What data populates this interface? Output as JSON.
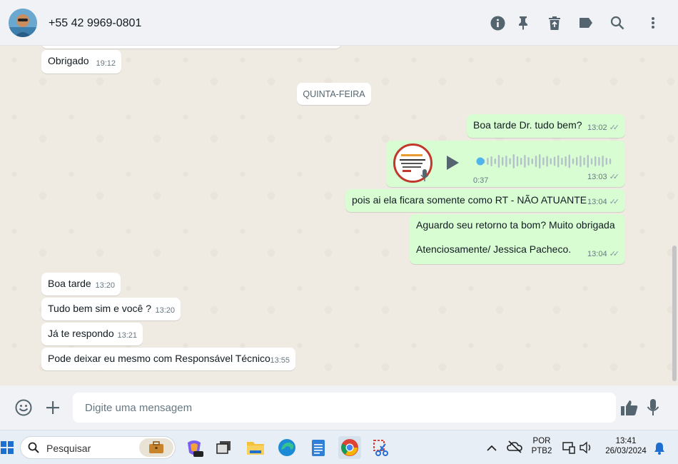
{
  "header": {
    "contact_name": "+55 42 9969-0801",
    "icons": [
      "info-icon",
      "pin-icon",
      "delete-icon",
      "label-icon",
      "search-icon",
      "menu-icon"
    ]
  },
  "chat": {
    "day_separator": "QUINTA-FEIRA",
    "messages": [
      {
        "dir": "in",
        "text": "Obrigado",
        "time": "19:12"
      },
      {
        "dir": "out",
        "text": "Boa tarde Dr. tudo bem?",
        "time": "13:02"
      },
      {
        "dir": "out",
        "type": "audio",
        "duration": "0:37",
        "time": "13:03",
        "progress": 0
      },
      {
        "dir": "out",
        "text": "pois ai ela ficara somente como RT - NÃO ATUANTE",
        "time": "13:04"
      },
      {
        "dir": "out",
        "text_line1": "Aguardo seu retorno ta bom? Muito obrigada",
        "text_line2": "Atenciosamente/ Jessica Pacheco.",
        "time": "13:04"
      },
      {
        "dir": "in",
        "text": "Boa tarde",
        "time": "13:20"
      },
      {
        "dir": "in",
        "text": "Tudo bem sim e você ?",
        "time": "13:20"
      },
      {
        "dir": "in",
        "text": "Já te respondo",
        "time": "13:21"
      },
      {
        "dir": "in",
        "text": "Pode deixar eu mesmo com Responsável Técnico",
        "time": "13:55"
      }
    ]
  },
  "composer": {
    "placeholder": "Digite uma mensagem"
  },
  "taskbar": {
    "search_placeholder": "Pesquisar",
    "lang_line1": "POR",
    "lang_line2": "PTB2",
    "clock_time": "13:41",
    "clock_date": "26/03/2024"
  },
  "colors": {
    "outgoing_bubble": "#d9fdd3",
    "incoming_bubble": "#ffffff",
    "chat_background": "#efeae2",
    "read_tick": "#8696a0"
  }
}
